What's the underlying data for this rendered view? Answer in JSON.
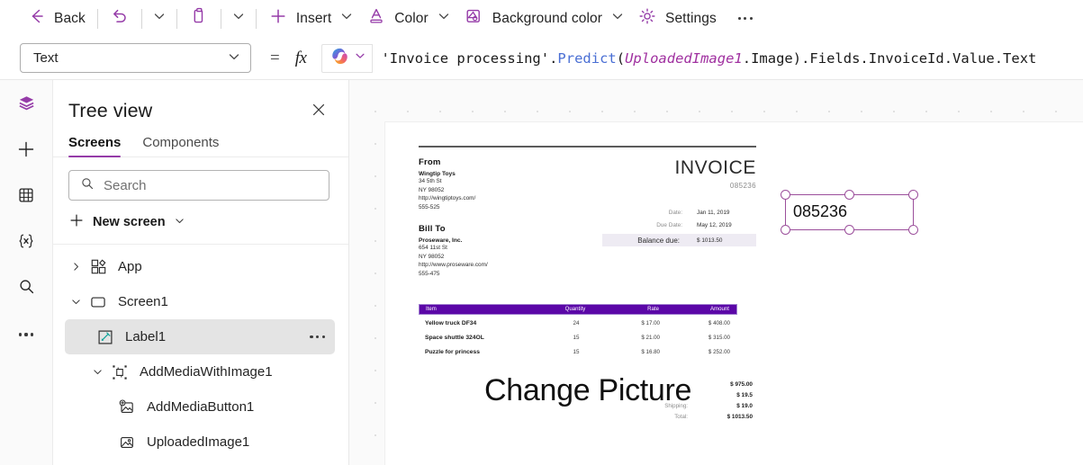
{
  "toolbar": {
    "back_label": "Back",
    "insert_label": "Insert",
    "color_label": "Color",
    "background_color_label": "Background color",
    "settings_label": "Settings",
    "accent_color": "#953BA8"
  },
  "formula_bar": {
    "property_value": "Text",
    "equals": "=",
    "fx": "fx",
    "formula_segments": [
      {
        "text": "'Invoice processing'",
        "kind": "plain"
      },
      {
        "text": ".",
        "kind": "plain"
      },
      {
        "text": "Predict",
        "kind": "fn"
      },
      {
        "text": "(",
        "kind": "paren"
      },
      {
        "text": "UploadedImage1",
        "kind": "ctrl"
      },
      {
        "text": ".Image)",
        "kind": "plain"
      },
      {
        "text": ".Fields.InvoiceId.Value.Text",
        "kind": "plain"
      }
    ],
    "formula_full": "'Invoice processing'.Predict(UploadedImage1.Image).Fields.InvoiceId.Value.Text"
  },
  "rail": {
    "items": [
      {
        "icon": "layers-icon",
        "active": true
      },
      {
        "icon": "plus-icon",
        "active": false
      },
      {
        "icon": "table-icon",
        "active": false
      },
      {
        "icon": "variables-icon",
        "active": false
      },
      {
        "icon": "search-icon",
        "active": false
      },
      {
        "icon": "more-icon",
        "active": false
      }
    ]
  },
  "tree_view": {
    "title": "Tree view",
    "tabs": [
      {
        "label": "Screens",
        "selected": true
      },
      {
        "label": "Components",
        "selected": false
      }
    ],
    "search": {
      "value": "",
      "placeholder": "Search"
    },
    "new_screen_label": "New screen",
    "items": [
      {
        "label": "App",
        "icon": "app-icon",
        "indent": 0,
        "twisty": "collapsed",
        "selected": false,
        "more": false
      },
      {
        "label": "Screen1",
        "icon": "screen-icon",
        "indent": 0,
        "twisty": "expanded",
        "selected": false,
        "more": false
      },
      {
        "label": "Label1",
        "icon": "label-icon",
        "indent": 1,
        "twisty": "none",
        "selected": true,
        "more": true
      },
      {
        "label": "AddMediaWithImage1",
        "icon": "group-icon",
        "indent": 1,
        "twisty": "expanded",
        "selected": false,
        "more": false
      },
      {
        "label": "AddMediaButton1",
        "icon": "add-media-icon",
        "indent": 2,
        "twisty": "none",
        "selected": false,
        "more": false
      },
      {
        "label": "UploadedImage1",
        "icon": "image-icon",
        "indent": 2,
        "twisty": "none",
        "selected": false,
        "more": false
      }
    ]
  },
  "canvas": {
    "change_picture_label": "Change Picture",
    "selected_control": {
      "name": "Label1",
      "text": "085236",
      "handle_color": "#9b4f9b"
    },
    "invoice": {
      "from_label": "From",
      "from_company": "Wingtip Toys",
      "from_lines": [
        "34 5th St",
        "NY 98052",
        "http://wingtiptoys.com/",
        "555-525"
      ],
      "bill_to_label": "Bill To",
      "bill_to_company": "Proseware, Inc.",
      "bill_to_lines": [
        "654 11st St",
        "NY 98052",
        "http://www.proseware.com/",
        "555-475"
      ],
      "title": "INVOICE",
      "number": "085236",
      "meta": [
        {
          "key": "Date:",
          "value": "Jan 11, 2019"
        },
        {
          "key": "Due Date:",
          "value": "May 12, 2019"
        }
      ],
      "balance_label": "Balance due:",
      "balance_value": "$ 1013.50",
      "table_headers": [
        "Item",
        "Quantity",
        "Rate",
        "Amount"
      ],
      "table_rows": [
        {
          "item": "Yellow truck DF34",
          "quantity": "24",
          "rate": "$ 17.00",
          "amount": "$ 408.00"
        },
        {
          "item": "Space shuttle 324OL",
          "quantity": "15",
          "rate": "$ 21.00",
          "amount": "$ 315.00"
        },
        {
          "item": "Puzzle for princess",
          "quantity": "15",
          "rate": "$ 16.80",
          "amount": "$ 252.00"
        }
      ],
      "totals": [
        {
          "key": "",
          "value": "$ 975.00"
        },
        {
          "key": "",
          "value": "$ 19.5"
        },
        {
          "key": "Shipping:",
          "value": "$ 19.0"
        },
        {
          "key": "Total:",
          "value": "$ 1013.50"
        }
      ],
      "header_bar_color": "#5B07A7",
      "balance_bg_color": "#eeebf3"
    }
  }
}
